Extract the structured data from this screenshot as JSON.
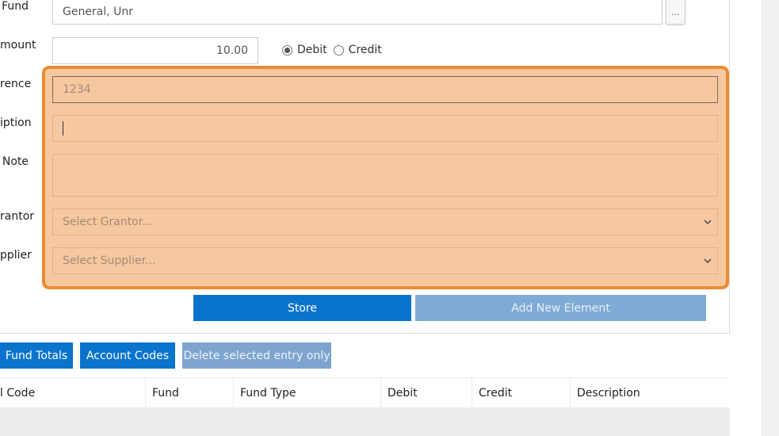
{
  "form": {
    "fund_label": "Fund",
    "fund_value": "General, Unr",
    "fund_lookup_label": "...",
    "amount_label": "mount",
    "amount_value": "10.00",
    "debit_label": "Debit",
    "credit_label": "Credit",
    "reference_label": "rence",
    "reference_value": "1234",
    "description_label": "iption",
    "note_label": "Note",
    "grantor_label": "rantor",
    "grantor_placeholder": "Select Grantor...",
    "supplier_label": "pplier",
    "supplier_placeholder": "Select Supplier..."
  },
  "actions": {
    "store_label": "Store",
    "add_new_element_label": "Add New Element",
    "fund_totals_label": "Fund Totals",
    "account_codes_label": "Account Codes",
    "delete_entry_label": "Delete selected entry only"
  },
  "table": {
    "columns": [
      "l Code",
      "Fund",
      "Fund Type",
      "Debit",
      "Credit",
      "Description"
    ]
  },
  "colors": {
    "primary": "#0a74cc",
    "highlight_fill": "#f6c8a0",
    "highlight_border": "#eb8a34"
  }
}
